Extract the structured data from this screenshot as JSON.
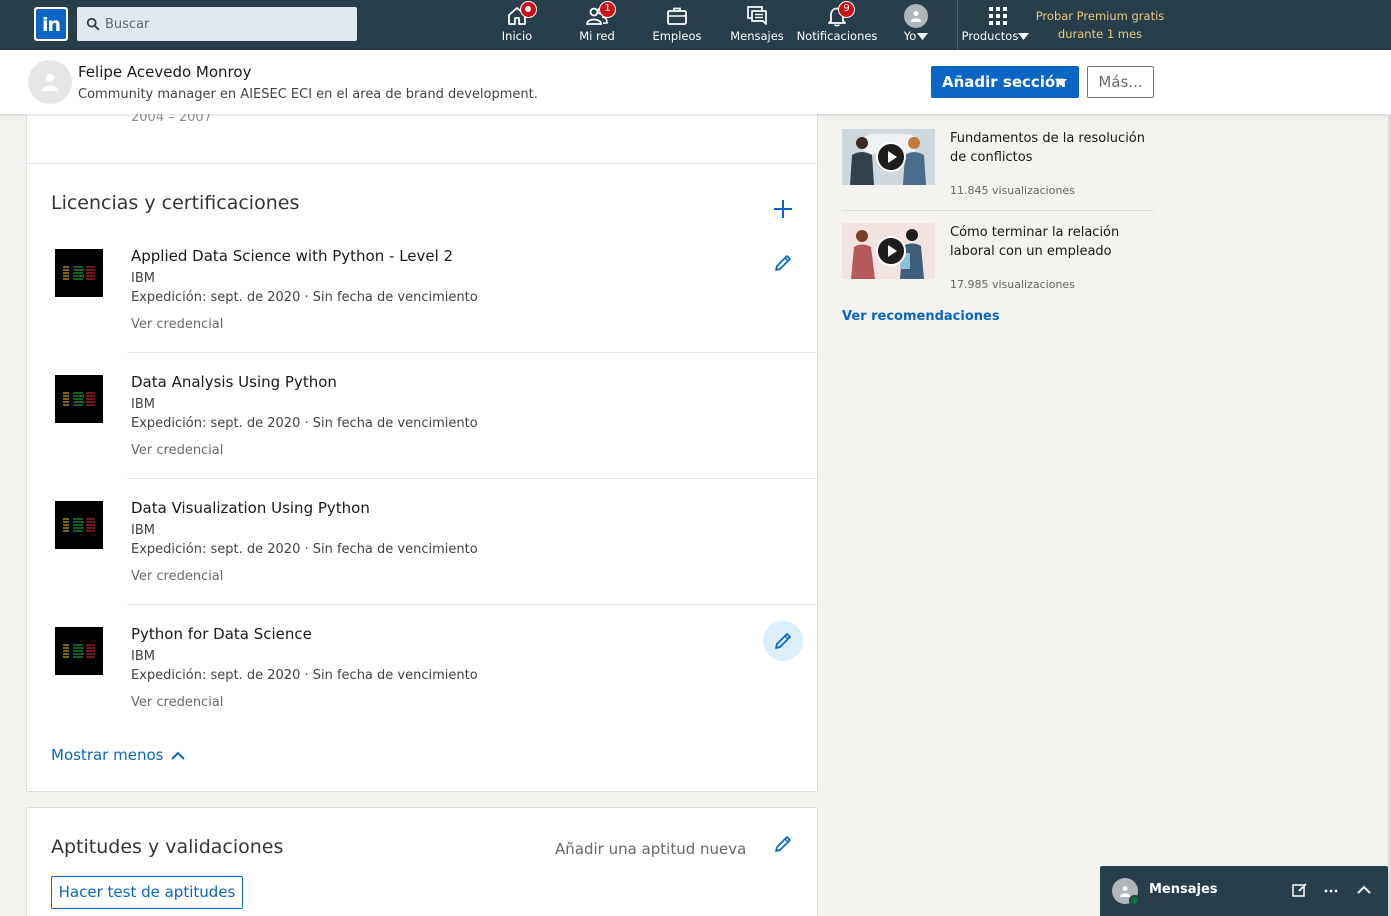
{
  "nav": {
    "search_placeholder": "Buscar",
    "items": [
      {
        "label": "Inicio",
        "badge": ""
      },
      {
        "label": "Mi red",
        "badge": "1"
      },
      {
        "label": "Empleos",
        "badge": ""
      },
      {
        "label": "Mensajes",
        "badge": ""
      },
      {
        "label": "Notificaciones",
        "badge": "9"
      },
      {
        "label": "Yo",
        "badge": ""
      },
      {
        "label": "Productos",
        "badge": ""
      }
    ],
    "premium_line1": "Probar Premium gratis",
    "premium_line2": "durante 1 mes"
  },
  "profile_bar": {
    "name": "Felipe Acevedo Monroy",
    "headline": "Community manager en AIESEC ECI en el area de brand development.",
    "add_section_label": "Añadir sección",
    "more_label": "Más..."
  },
  "previous_section_date": "2004 – 2007",
  "certifications": {
    "title": "Licencias y certificaciones",
    "items": [
      {
        "title": "Applied Data Science with Python - Level 2",
        "org": "IBM",
        "issued": "Expedición: sept. de 2020 · Sin fecha de vencimiento",
        "link": "Ver credencial",
        "logo_text": "IBM"
      },
      {
        "title": "Data Analysis Using Python",
        "org": "IBM",
        "issued": "Expedición: sept. de 2020 · Sin fecha de vencimiento",
        "link": "Ver credencial",
        "logo_text": "IBM"
      },
      {
        "title": "Data Visualization Using Python",
        "org": "IBM",
        "issued": "Expedición: sept. de 2020 · Sin fecha de vencimiento",
        "link": "Ver credencial",
        "logo_text": "IBM"
      },
      {
        "title": "Python for Data Science",
        "org": "IBM",
        "issued": "Expedición: sept. de 2020 · Sin fecha de vencimiento",
        "link": "Ver credencial",
        "logo_text": "IBM"
      }
    ],
    "show_less_label": "Mostrar menos"
  },
  "skills": {
    "title": "Aptitudes y validaciones",
    "add_label": "Añadir una aptitud nueva",
    "test_button_label": "Hacer test de aptitudes"
  },
  "rail": {
    "courses": [
      {
        "title": "Fundamentos de la resolución de conflictos",
        "views": "11.845 visualizaciones"
      },
      {
        "title": "Cómo terminar la relación laboral con un empleado",
        "views": "17.985 visualizaciones"
      }
    ],
    "see_more_label": "Ver recomendaciones"
  },
  "messaging": {
    "label": "Mensajes"
  },
  "colors": {
    "nav_bg": "#283e4a",
    "accent": "#0a66c2",
    "premium": "#e7c883",
    "badge": "#cc1016"
  }
}
